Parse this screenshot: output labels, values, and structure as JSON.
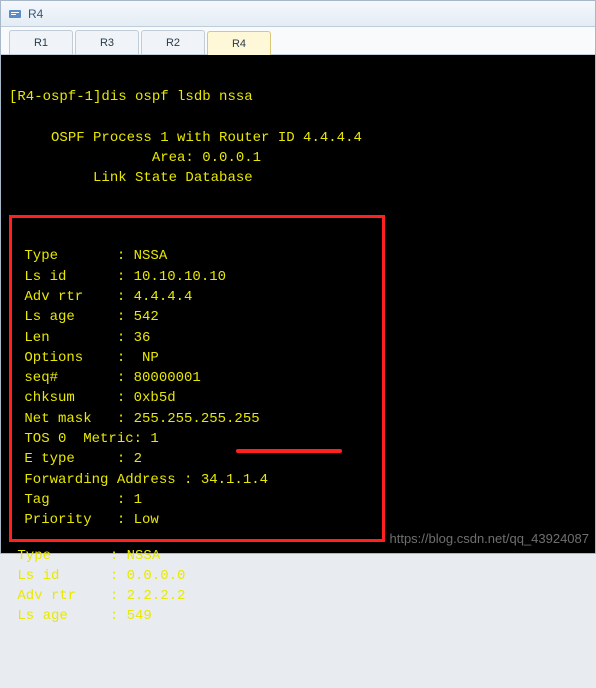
{
  "window": {
    "title": "R4"
  },
  "tabs": {
    "t0": "R1",
    "t1": "R3",
    "t2": "R2",
    "t3": "R4",
    "active_index": 3
  },
  "terminal": {
    "prompt": "[R4-ospf-1]",
    "command": "dis ospf lsdb nssa",
    "header": {
      "line1": "OSPF Process 1 with Router ID 4.4.4.4",
      "line2": "Area: 0.0.0.1",
      "line3": "Link State Database"
    },
    "lsa1": {
      "type": " Type       : NSSA",
      "ls_id": " Ls id      : 10.10.10.10",
      "adv_rtr": " Adv rtr    : 4.4.4.4",
      "ls_age": " Ls age     : 542",
      "len": " Len        : 36",
      "options": " Options    :  NP",
      "seq": " seq#       : 80000001",
      "chksum": " chksum     : 0xb5d",
      "net_mask": " Net mask   : 255.255.255.255",
      "tos": " TOS 0  Metric: 1",
      "e_type": " E type     : 2",
      "fwd_addr": " Forwarding Address : 34.1.1.4",
      "tag": " Tag        : 1",
      "priority": " Priority   : Low"
    },
    "lsa2": {
      "type": " Type       : NSSA",
      "ls_id": " Ls id      : 0.0.0.0",
      "adv_rtr": " Adv rtr    : 2.2.2.2",
      "ls_age": " Ls age     : 549"
    }
  },
  "annotation": {
    "underline_color": "#ff2020"
  },
  "watermark": "https://blog.csdn.net/qq_43924087",
  "chart_data": {
    "type": "table",
    "title": "OSPF LSDB NSSA entry (highlighted)",
    "fields": [
      "Type",
      "Ls id",
      "Adv rtr",
      "Ls age",
      "Len",
      "Options",
      "seq#",
      "chksum",
      "Net mask",
      "TOS 0 Metric",
      "E type",
      "Forwarding Address",
      "Tag",
      "Priority"
    ],
    "values": [
      "NSSA",
      "10.10.10.10",
      "4.4.4.4",
      542,
      36,
      "NP",
      "80000001",
      "0xb5d",
      "255.255.255.255",
      1,
      2,
      "34.1.1.4",
      1,
      "Low"
    ]
  }
}
